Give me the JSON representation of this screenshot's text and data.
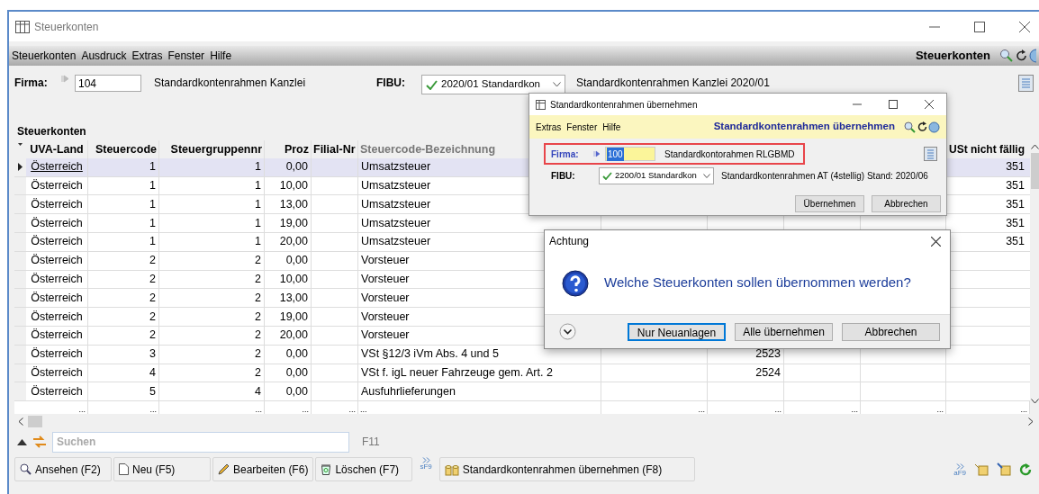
{
  "window": {
    "title": "Steuerkonten"
  },
  "menu": [
    "Steuerkonten",
    "Ausdruck",
    "Extras",
    "Fenster",
    "Hilfe"
  ],
  "toolbar_title": "Steuerkonten",
  "form": {
    "firma_label": "Firma:",
    "firma_value": "104",
    "firma_name": "Standardkontenrahmen Kanzlei",
    "fibu_label": "FIBU:",
    "fibu_value": "2020/01 Standardkon",
    "fibu_description": "Standardkontenrahmen Kanzlei 2020/01"
  },
  "table": {
    "title": "Steuerkonten",
    "columns": [
      "UVA-Land",
      "Steuercode",
      "Steuergruppennr",
      "Proz",
      "Filial-Nr",
      "Steuercode-Bezeichnung",
      "USt nicht fällig"
    ],
    "rows": [
      {
        "uva_land": "Österreich",
        "steuercode": "1",
        "steuergruppennr": "1",
        "proz": "0,00",
        "bezeichnung": "Umsatzsteuer",
        "ust_nicht_faellig": "351",
        "selected": true
      },
      {
        "uva_land": "Österreich",
        "steuercode": "1",
        "steuergruppennr": "1",
        "proz": "10,00",
        "bezeichnung": "Umsatzsteuer",
        "ust_nicht_faellig": "351",
        "selected": false
      },
      {
        "uva_land": "Österreich",
        "steuercode": "1",
        "steuergruppennr": "1",
        "proz": "13,00",
        "bezeichnung": "Umsatzsteuer",
        "ust_nicht_faellig": "351",
        "selected": false
      },
      {
        "uva_land": "Österreich",
        "steuercode": "1",
        "steuergruppennr": "1",
        "proz": "19,00",
        "bezeichnung": "Umsatzsteuer",
        "ust_nicht_faellig": "351",
        "selected": false
      },
      {
        "uva_land": "Österreich",
        "steuercode": "1",
        "steuergruppennr": "1",
        "proz": "20,00",
        "bezeichnung": "Umsatzsteuer",
        "ust_nicht_faellig": "351",
        "selected": false
      },
      {
        "uva_land": "Österreich",
        "steuercode": "2",
        "steuergruppennr": "2",
        "proz": "0,00",
        "bezeichnung": "Vorsteuer",
        "selected": false
      },
      {
        "uva_land": "Österreich",
        "steuercode": "2",
        "steuergruppennr": "2",
        "proz": "10,00",
        "bezeichnung": "Vorsteuer",
        "selected": false
      },
      {
        "uva_land": "Österreich",
        "steuercode": "2",
        "steuergruppennr": "2",
        "proz": "13,00",
        "bezeichnung": "Vorsteuer",
        "selected": false
      },
      {
        "uva_land": "Österreich",
        "steuercode": "2",
        "steuergruppennr": "2",
        "proz": "19,00",
        "bezeichnung": "Vorsteuer",
        "selected": false
      },
      {
        "uva_land": "Österreich",
        "steuercode": "2",
        "steuergruppennr": "2",
        "proz": "20,00",
        "bezeichnung": "Vorsteuer",
        "selected": false
      },
      {
        "uva_land": "Österreich",
        "steuercode": "3",
        "steuergruppennr": "2",
        "proz": "0,00",
        "bezeichnung": "VSt §12/3 iVm Abs. 4 und 5",
        "column_8": "2523",
        "selected": false
      },
      {
        "uva_land": "Österreich",
        "steuercode": "4",
        "steuergruppennr": "2",
        "proz": "0,00",
        "bezeichnung": "VSt f. igL neuer Fahrzeuge gem. Art. 2",
        "column_8": "2524",
        "selected": false
      },
      {
        "uva_land": "Österreich",
        "steuercode": "5",
        "steuergruppennr": "4",
        "proz": "0,00",
        "bezeichnung": "Ausfuhrlieferungen",
        "selected": false
      }
    ],
    "partial_row": [
      "...",
      "...",
      "...",
      "...",
      "...",
      "...",
      "...",
      "...",
      "...",
      "...",
      "..."
    ]
  },
  "search": {
    "placeholder": "Suchen",
    "shortcut": "F11"
  },
  "buttons": [
    {
      "label": "Ansehen (F2)",
      "kind": "view"
    },
    {
      "label": "Neu (F5)",
      "kind": "new"
    },
    {
      "label": "Bearbeiten (F6)",
      "kind": "edit"
    },
    {
      "label": "Löschen (F7)",
      "kind": "delete"
    },
    {
      "label": "Standardkontenrahmen übernehmen (F8)",
      "kind": "import",
      "badge": "sF9"
    }
  ],
  "right_tools": {
    "badge": "aF9"
  },
  "import_dialog": {
    "title": "Standardkontenrahmen übernehmen",
    "menu": [
      "Extras",
      "Fenster",
      "Hilfe"
    ],
    "heading": "Standardkontenrahmen übernehmen",
    "firma_label": "Firma:",
    "firma_value": "100",
    "firma_name": "Standardkontorahmen RLGBMD",
    "fibu_label": "FIBU:",
    "fibu_value": "2200/01 Standardkon",
    "fibu_description": "Standardkontenrahmen AT (4stellig) Stand: 2020/06",
    "buttons": [
      "Übernehmen",
      "Abbrechen"
    ]
  },
  "alert": {
    "title": "Achtung",
    "message": "Welche Steuerkonten sollen übernommen werden?",
    "buttons": [
      {
        "label": "Nur Neuanlagen",
        "default": true
      },
      {
        "label": "Alle übernehmen",
        "default": false
      },
      {
        "label": "Abbrechen",
        "default": false
      }
    ]
  }
}
